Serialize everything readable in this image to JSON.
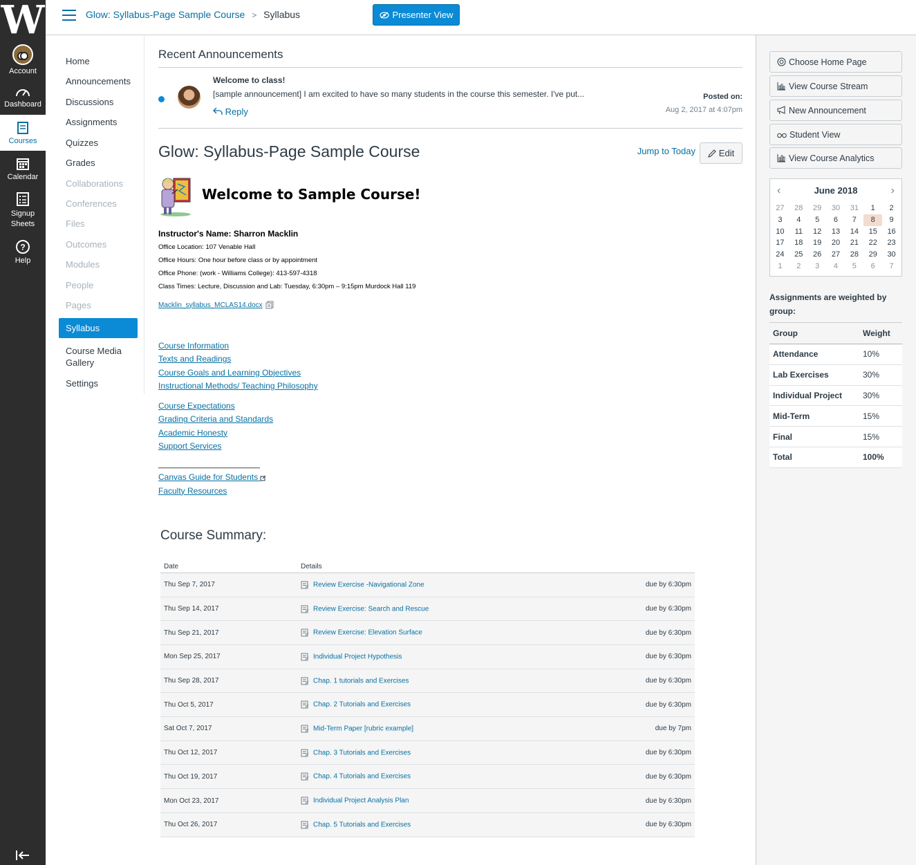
{
  "global_nav": {
    "logo": "W",
    "items": [
      {
        "label": "Account",
        "icon": "owl-avatar-icon"
      },
      {
        "label": "Dashboard",
        "icon": "dashboard-icon"
      },
      {
        "label": "Courses",
        "icon": "book-icon"
      },
      {
        "label": "Calendar",
        "icon": "calendar-icon"
      },
      {
        "label": "Signup Sheets",
        "icon": "signup-sheets-icon"
      },
      {
        "label": "Help",
        "icon": "help-icon"
      }
    ],
    "collapse_icon": "collapse-nav-icon"
  },
  "header": {
    "course_link": "Glow: Syllabus-Page Sample Course",
    "separator": ">",
    "current": "Syllabus",
    "presenter_button": "Presenter View"
  },
  "course_nav": {
    "items": [
      {
        "label": "Home",
        "state": "enabled"
      },
      {
        "label": "Announcements",
        "state": "enabled"
      },
      {
        "label": "Discussions",
        "state": "enabled"
      },
      {
        "label": "Assignments",
        "state": "enabled"
      },
      {
        "label": "Quizzes",
        "state": "enabled"
      },
      {
        "label": "Grades",
        "state": "enabled"
      },
      {
        "label": "Collaborations",
        "state": "disabled"
      },
      {
        "label": "Conferences",
        "state": "disabled"
      },
      {
        "label": "Files",
        "state": "disabled"
      },
      {
        "label": "Outcomes",
        "state": "disabled"
      },
      {
        "label": "Modules",
        "state": "disabled"
      },
      {
        "label": "People",
        "state": "disabled"
      },
      {
        "label": "Pages",
        "state": "disabled"
      },
      {
        "label": "Syllabus",
        "state": "active"
      },
      {
        "label": "Course Media Gallery",
        "state": "enabled"
      },
      {
        "label": "Settings",
        "state": "enabled"
      }
    ]
  },
  "announcements": {
    "heading": "Recent Announcements",
    "items": [
      {
        "title": "Welcome to class!",
        "body": "[sample announcement] I am excited to have so many students in the course this semester. I've put...",
        "reply": "Reply",
        "posted_label": "Posted on:",
        "posted_date": "Aug 2, 2017 at 4:07pm"
      }
    ]
  },
  "syllabus": {
    "title": "Glow: Syllabus-Page Sample Course",
    "jump_today": "Jump to Today",
    "edit": "Edit",
    "welcome": "Welcome to Sample Course!",
    "instructor": "Instructor's Name: Sharron Macklin",
    "info_lines": [
      "Office Location: 107 Venable Hall",
      "Office Hours: One hour before class or by appointment",
      "Office Phone: (work - Williams College): 413-597-4318",
      "Class Times: Lecture, Discussion and Lab: Tuesday, 6:30pm – 9:15pm Murdock Hall 119"
    ],
    "file": "Macklin_syllabus_MCLAS14.docx",
    "links_group1": [
      "Course Information",
      "Texts and Readings",
      "Course Goals and Learning Objectives",
      "Instructional Methods/ Teaching Philosophy"
    ],
    "links_group2": [
      "Course Expectations",
      "Grading Criteria and Standards",
      "Academic Honesty",
      "Support Services"
    ],
    "rule": "________________________",
    "links_group3": [
      "Canvas Guide for Students",
      "Faculty Resources"
    ]
  },
  "summary": {
    "heading": "Course Summary:",
    "columns": [
      "Date",
      "Details"
    ],
    "rows": [
      {
        "date": "Thu Sep 7, 2017",
        "title": "Review Exercise -Navigational Zone",
        "due": "due by 6:30pm"
      },
      {
        "date": "Thu Sep 14, 2017",
        "title": "Review Exercise: Search and Rescue",
        "due": "due by 6:30pm"
      },
      {
        "date": "Thu Sep 21, 2017",
        "title": "Review Exercise: Elevation Surface",
        "due": "due by 6:30pm"
      },
      {
        "date": "Mon Sep 25, 2017",
        "title": "Individual Project Hypothesis",
        "due": "due by 6:30pm"
      },
      {
        "date": "Thu Sep 28, 2017",
        "title": "Chap. 1 tutorials and Exercises",
        "due": "due by 6:30pm"
      },
      {
        "date": "Thu Oct 5, 2017",
        "title": "Chap. 2 Tutorials and Exercises",
        "due": "due by 6:30pm"
      },
      {
        "date": "Sat Oct 7, 2017",
        "title": "Mid-Term Paper [rubric example]",
        "due": "due by 7pm"
      },
      {
        "date": "Thu Oct 12, 2017",
        "title": "Chap. 3 Tutorials and Exercises",
        "due": "due by 6:30pm"
      },
      {
        "date": "Thu Oct 19, 2017",
        "title": "Chap. 4 Tutorials and Exercises",
        "due": "due by 6:30pm"
      },
      {
        "date": "Mon Oct 23, 2017",
        "title": "Individual Project Analysis Plan",
        "due": "due by 6:30pm"
      },
      {
        "date": "Thu Oct 26, 2017",
        "title": "Chap. 5 Tutorials and Exercises",
        "due": "due by 6:30pm"
      }
    ]
  },
  "sidebar": {
    "buttons": [
      {
        "label": "Choose Home Page",
        "icon": "target-icon"
      },
      {
        "label": "View Course Stream",
        "icon": "stream-icon"
      },
      {
        "label": "New Announcement",
        "icon": "megaphone-icon"
      },
      {
        "label": "Student View",
        "icon": "glasses-icon"
      },
      {
        "label": "View Course Analytics",
        "icon": "analytics-icon"
      }
    ],
    "calendar": {
      "month": "June 2018",
      "days": [
        {
          "d": "27",
          "other": true
        },
        {
          "d": "28",
          "other": true
        },
        {
          "d": "29",
          "other": true
        },
        {
          "d": "30",
          "other": true
        },
        {
          "d": "31",
          "other": true
        },
        {
          "d": "1"
        },
        {
          "d": "2"
        },
        {
          "d": "3"
        },
        {
          "d": "4"
        },
        {
          "d": "5"
        },
        {
          "d": "6"
        },
        {
          "d": "7"
        },
        {
          "d": "8",
          "today": true
        },
        {
          "d": "9"
        },
        {
          "d": "10"
        },
        {
          "d": "11"
        },
        {
          "d": "12"
        },
        {
          "d": "13"
        },
        {
          "d": "14"
        },
        {
          "d": "15"
        },
        {
          "d": "16"
        },
        {
          "d": "17"
        },
        {
          "d": "18"
        },
        {
          "d": "19"
        },
        {
          "d": "20"
        },
        {
          "d": "21"
        },
        {
          "d": "22"
        },
        {
          "d": "23"
        },
        {
          "d": "24"
        },
        {
          "d": "25"
        },
        {
          "d": "26"
        },
        {
          "d": "27"
        },
        {
          "d": "28"
        },
        {
          "d": "29"
        },
        {
          "d": "30"
        },
        {
          "d": "1",
          "other": true
        },
        {
          "d": "2",
          "other": true
        },
        {
          "d": "3",
          "other": true
        },
        {
          "d": "4",
          "other": true
        },
        {
          "d": "5",
          "other": true
        },
        {
          "d": "6",
          "other": true
        },
        {
          "d": "7",
          "other": true
        }
      ]
    },
    "weights_heading": "Assignments are weighted by group:",
    "weights_columns": [
      "Group",
      "Weight"
    ],
    "weights": [
      {
        "group": "Attendance",
        "weight": "10%"
      },
      {
        "group": "Lab Exercises",
        "weight": "30%"
      },
      {
        "group": "Individual Project",
        "weight": "30%"
      },
      {
        "group": "Mid-Term",
        "weight": "15%"
      },
      {
        "group": "Final",
        "weight": "15%"
      },
      {
        "group": "Total",
        "weight": "100%"
      }
    ]
  },
  "colors": {
    "nav_bg": "#2d2d2d",
    "link": "#0770a3",
    "accent": "#0b8ad6",
    "today": "#f4dbd0"
  }
}
